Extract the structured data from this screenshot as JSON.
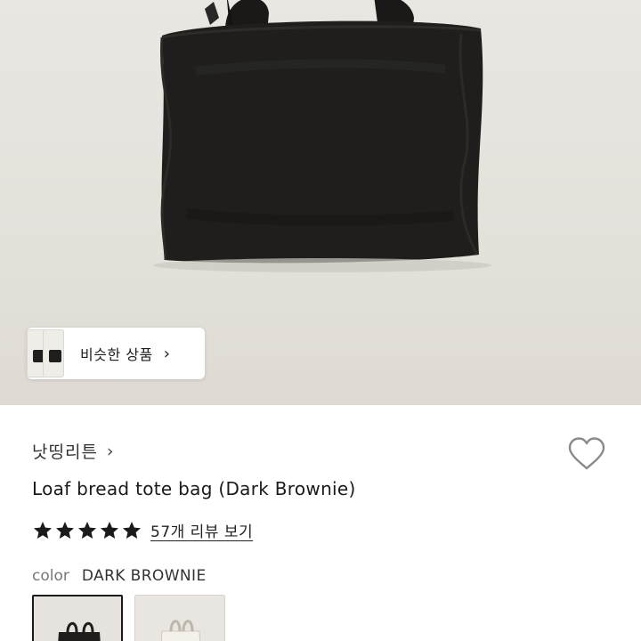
{
  "similar": {
    "label": "비슷한 상품",
    "chevron": "›"
  },
  "brand": {
    "name": "낫띵리튼",
    "chevron": "›"
  },
  "product": {
    "title": "Loaf bread tote bag (Dark Brownie)"
  },
  "rating": {
    "stars": 5,
    "filled_stars": 5,
    "review_link": "57개 리뷰 보기"
  },
  "color": {
    "label": "color",
    "value": "DARK BROWNIE"
  },
  "swatches": [
    {
      "name": "DARK BROWNIE",
      "selected": true
    },
    {
      "name": "",
      "selected": false
    }
  ],
  "icons": {
    "wishlist": "heart-outline-icon",
    "star": "star-filled-icon"
  },
  "colors": {
    "bag": "#1f1e1c",
    "star": "#1a1a1a",
    "heart_stroke": "#8a8a8a"
  }
}
